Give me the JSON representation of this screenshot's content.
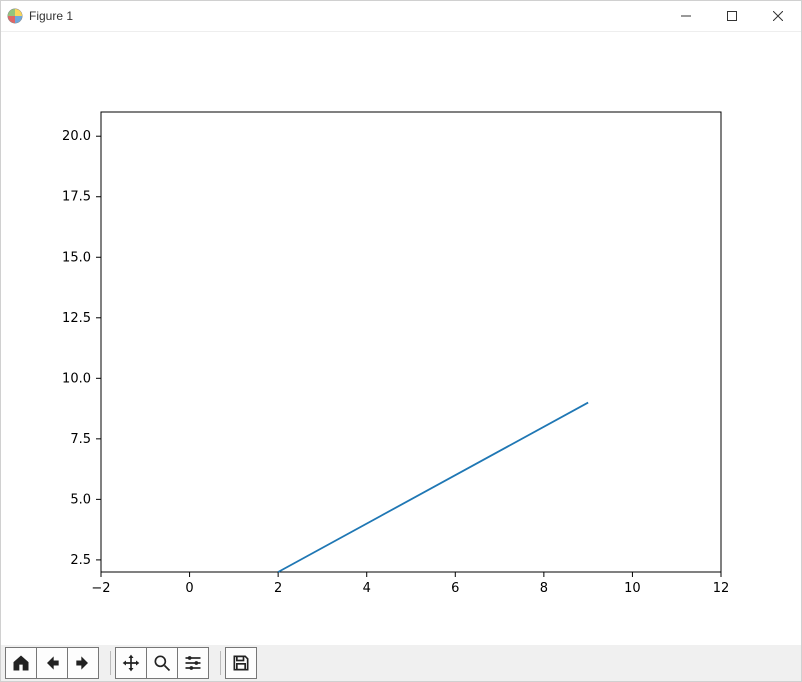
{
  "window": {
    "title": "Figure 1"
  },
  "chart_data": {
    "type": "line",
    "x": [
      2,
      9
    ],
    "y": [
      2,
      9
    ],
    "xlim": [
      -2,
      12
    ],
    "ylim": [
      2,
      21
    ],
    "xticks": [
      -2,
      0,
      2,
      4,
      6,
      8,
      10,
      12
    ],
    "yticks": [
      2.5,
      5.0,
      7.5,
      10.0,
      12.5,
      15.0,
      17.5,
      20.0
    ],
    "xtick_labels": [
      "−2",
      "0",
      "2",
      "4",
      "6",
      "8",
      "10",
      "12"
    ],
    "ytick_labels": [
      "2.5",
      "5.0",
      "7.5",
      "10.0",
      "12.5",
      "15.0",
      "17.5",
      "20.0"
    ],
    "line_color": "#1f77b4",
    "title": "",
    "xlabel": "",
    "ylabel": ""
  },
  "toolbar": {
    "home": "Home",
    "back": "Back",
    "forward": "Forward",
    "pan": "Pan",
    "zoom": "Zoom",
    "configure": "Configure subplots",
    "save": "Save"
  }
}
